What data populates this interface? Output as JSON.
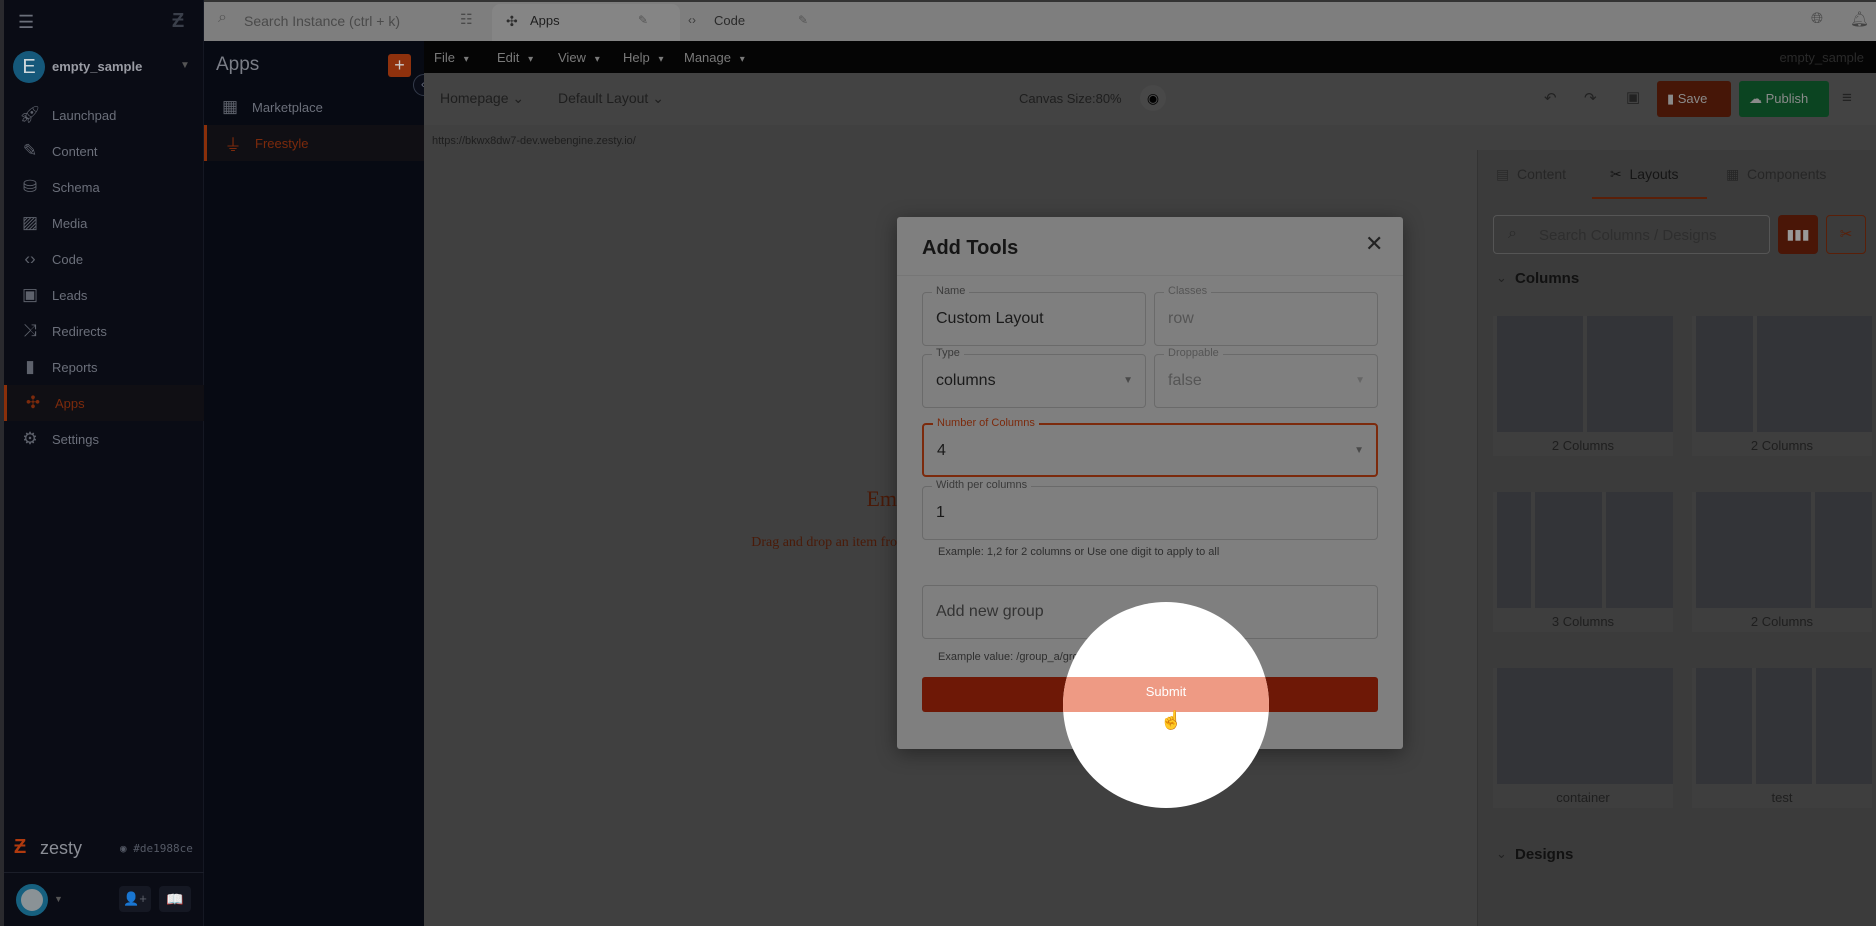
{
  "topbar": {
    "search_placeholder": "Search Instance (ctrl + k)",
    "tabs": [
      {
        "label": "Apps",
        "icon": "puzzle-icon"
      },
      {
        "label": "Code",
        "icon": "code-icon"
      }
    ]
  },
  "instance": {
    "initial": "E",
    "name": "empty_sample"
  },
  "nav": [
    {
      "label": "Launchpad",
      "icon": "rocket-icon"
    },
    {
      "label": "Content",
      "icon": "pencil-icon"
    },
    {
      "label": "Schema",
      "icon": "database-icon"
    },
    {
      "label": "Media",
      "icon": "image-icon"
    },
    {
      "label": "Code",
      "icon": "code-icon"
    },
    {
      "label": "Leads",
      "icon": "contact-icon"
    },
    {
      "label": "Redirects",
      "icon": "shuffle-icon"
    },
    {
      "label": "Reports",
      "icon": "bar-chart-icon"
    },
    {
      "label": "Apps",
      "icon": "puzzle-icon",
      "active": true
    },
    {
      "label": "Settings",
      "icon": "gear-icon"
    }
  ],
  "footer": {
    "logo": "zesty",
    "version": "#de1988ce"
  },
  "apps": {
    "title": "Apps",
    "items": [
      {
        "label": "Marketplace",
        "icon": "store-icon"
      },
      {
        "label": "Freestyle",
        "icon": "plug-icon",
        "active": true
      }
    ]
  },
  "menu": {
    "items": [
      "File",
      "Edit",
      "View",
      "Help",
      "Manage"
    ],
    "instance": "empty_sample"
  },
  "toolbar": {
    "page": "Homepage",
    "layout": "Default Layout",
    "canvas_size": "Canvas Size:80%",
    "save": "Save",
    "publish": "Publish"
  },
  "url": "https://bkwx8dw7-dev.webengine.zesty.io/",
  "canvas": {
    "heading_fragment": "Em",
    "text_fragment": "Drag and drop an item fro"
  },
  "right_panel": {
    "tabs": [
      {
        "label": "Content",
        "icon": "document-icon"
      },
      {
        "label": "Layouts",
        "icon": "tools-icon",
        "active": true
      },
      {
        "label": "Components",
        "icon": "grid-icon"
      }
    ],
    "search_placeholder": "Search Columns / Designs",
    "columns_header": "Columns",
    "designs_header": "Designs",
    "cards": [
      "2 Columns",
      "2 Columns",
      "3 Columns",
      "2 Columns",
      "container",
      "test"
    ]
  },
  "dialog": {
    "title": "Add Tools",
    "name_label": "Name",
    "name_value": "Custom Layout",
    "classes_label": "Classes",
    "classes_value": "row",
    "type_label": "Type",
    "type_value": "columns",
    "droppable_label": "Droppable",
    "droppable_value": "false",
    "columns_label": "Number of Columns",
    "columns_value": "4",
    "width_label": "Width per columns",
    "width_value": "1",
    "width_help": "Example: 1,2 for 2 columns or Use one digit to apply to all",
    "group_placeholder": "Add new group",
    "group_help": "Example value: /group_a/group_b",
    "submit": "Submit"
  },
  "colors": {
    "accent": "#c2410c",
    "publish": "#15803d"
  }
}
